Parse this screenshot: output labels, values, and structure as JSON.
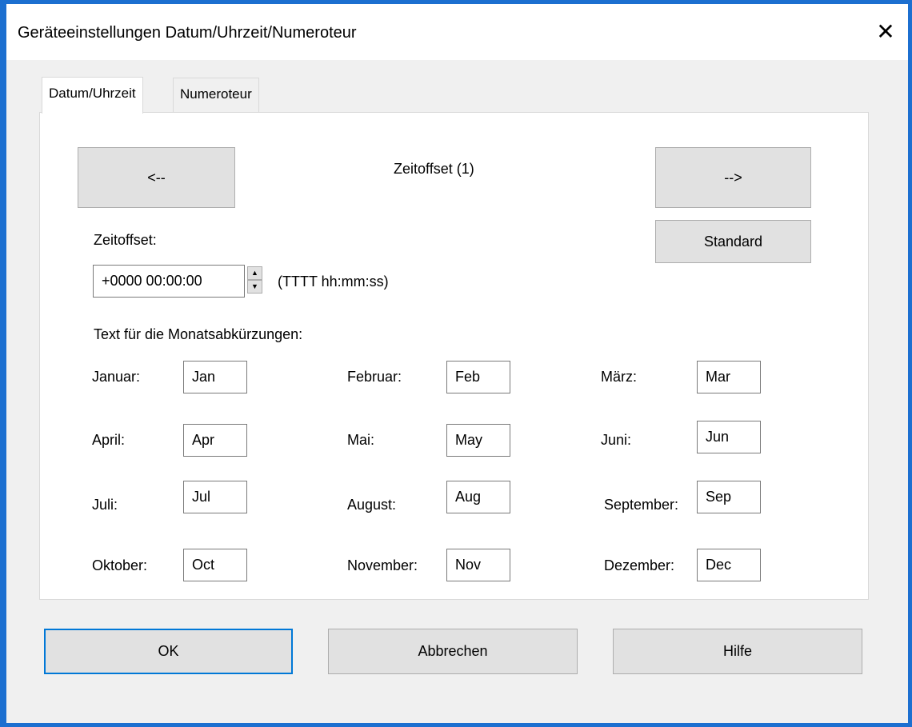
{
  "window": {
    "title": "Geräteeinstellungen Datum/Uhrzeit/Numeroteur",
    "close_glyph": "✕"
  },
  "tabs": [
    {
      "label": "Datum/Uhrzeit",
      "active": true
    },
    {
      "label": "Numeroteur",
      "active": false
    }
  ],
  "panel": {
    "prev_label": "<--",
    "next_label": "-->",
    "heading": "Zeitoffset (1)",
    "standard_label": "Standard",
    "offset_label": "Zeitoffset:",
    "offset_value": "+0000 00:00:00",
    "offset_format": "(TTTT hh:mm:ss)",
    "months_heading": "Text für die Monatsabkürzungen:",
    "months": [
      {
        "label": "Januar:",
        "value": "Jan"
      },
      {
        "label": "Februar:",
        "value": "Feb"
      },
      {
        "label": "März:",
        "value": "Mar"
      },
      {
        "label": "April:",
        "value": "Apr"
      },
      {
        "label": "Mai:",
        "value": "May"
      },
      {
        "label": "Juni:",
        "value": "Jun"
      },
      {
        "label": "Juli:",
        "value": "Jul"
      },
      {
        "label": "August:",
        "value": "Aug"
      },
      {
        "label": "September:",
        "value": "Sep"
      },
      {
        "label": "Oktober:",
        "value": "Oct"
      },
      {
        "label": "November:",
        "value": "Nov"
      },
      {
        "label": "Dezember:",
        "value": "Dec"
      }
    ]
  },
  "footer": {
    "ok_label": "OK",
    "cancel_label": "Abbrechen",
    "help_label": "Hilfe"
  },
  "colors": {
    "accent": "#0078d7",
    "window_border": "#1c6fd0",
    "button_face": "#e1e1e1"
  }
}
